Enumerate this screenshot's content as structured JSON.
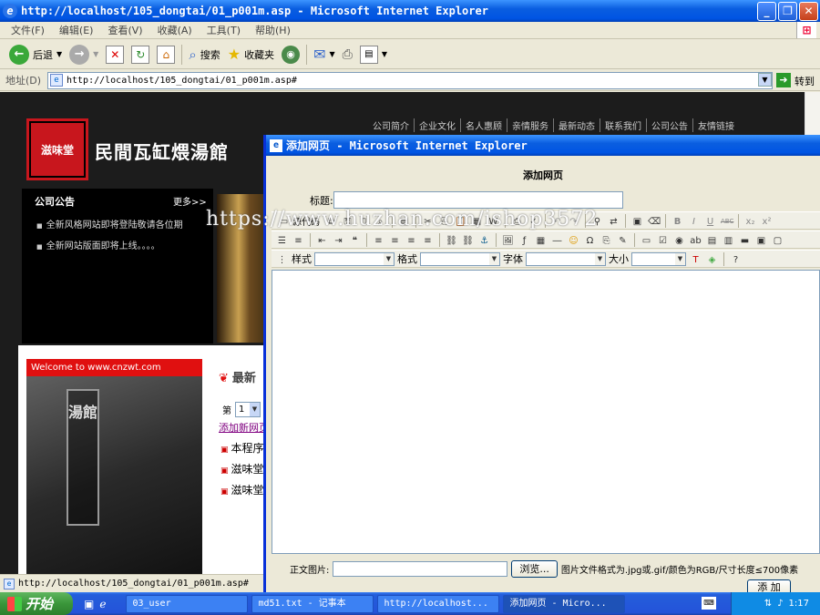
{
  "window": {
    "title": "http://localhost/105_dongtai/01_p001m.asp - Microsoft Internet Explorer",
    "min_icon": "minimize-icon",
    "max_icon": "maximize-icon",
    "close_icon": "close-icon"
  },
  "menu": [
    "文件(F)",
    "编辑(E)",
    "查看(V)",
    "收藏(A)",
    "工具(T)",
    "帮助(H)"
  ],
  "toolbar": {
    "back": "后退",
    "search": "搜索",
    "favorites": "收藏夹"
  },
  "address": {
    "label": "地址(D)",
    "url": "http://localhost/105_dongtai/01_p001m.asp#",
    "go": "转到"
  },
  "site": {
    "logo_text": "滋味堂",
    "name": "民間瓦缸煨湯館",
    "nav": [
      "公司简介",
      "企业文化",
      "名人惠顾",
      "亲情服务",
      "最新动态",
      "联系我们",
      "公司公告",
      "友情链接"
    ],
    "notice_title": "公司公告",
    "notice_more": "更多>>",
    "notice_items": [
      "全新风格网站即将登陆敬请各位期",
      "全新网站版面即将上线。。。。"
    ],
    "welcome": "Welcome to www.cnzwt.com",
    "sign_text": "湯館",
    "newest": "最新",
    "page_prefix": "第",
    "page_value": "1",
    "add_link": "添加新网页",
    "list": [
      "本程序",
      "滋味堂",
      "滋味堂"
    ]
  },
  "watermark": "https://www.huzhan.com/ishop3572",
  "dialog": {
    "title": "添加网页 - Microsoft Internet Explorer",
    "heading": "添加网页",
    "title_label": "标题:",
    "source_label": "源代码",
    "style_label": "样式",
    "format_label": "格式",
    "font_label": "字体",
    "size_label": "大小",
    "image_label": "正文图片:",
    "browse": "浏览...",
    "image_hint": "图片文件格式为.jpg或.gif/颜色为RGB/尺寸长度≤700像素",
    "add_button": "添 加"
  },
  "status": {
    "url": "http://localhost/105_dongtai/01_p001m.asp#"
  },
  "taskbar": {
    "start": "开始",
    "tasks": [
      "03_user",
      "md51.txt - 记事本",
      "http://localhost...",
      "添加网页 - Micro..."
    ],
    "clock": "1:17"
  }
}
